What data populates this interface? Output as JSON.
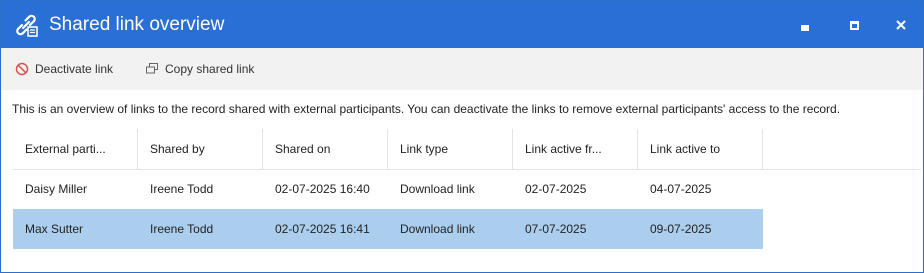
{
  "window": {
    "title": "Shared link overview",
    "icon": "shared-link-icon",
    "title_bar_color": "#2a6fd6"
  },
  "toolbar": {
    "deactivate_label": "Deactivate link",
    "deactivate_icon": "prohibited-icon",
    "copy_label": "Copy shared link",
    "copy_icon": "copy-icon"
  },
  "description": "This is an overview of links to the record shared with external participants. You can deactivate the links to remove external participants' access to the record.",
  "table": {
    "columns": [
      "External parti...",
      "Shared by",
      "Shared on",
      "Link type",
      "Link active fr...",
      "Link active to"
    ],
    "rows": [
      [
        "Daisy Miller",
        "Ireene Todd",
        "02-07-2025 16:40",
        "Download link",
        "02-07-2025",
        "04-07-2025"
      ],
      [
        "Max Sutter",
        "Ireene Todd",
        "02-07-2025 16:41",
        "Download link",
        "07-07-2025",
        "09-07-2025"
      ]
    ],
    "selected_row": 1,
    "selected_color": "#abcdee"
  }
}
